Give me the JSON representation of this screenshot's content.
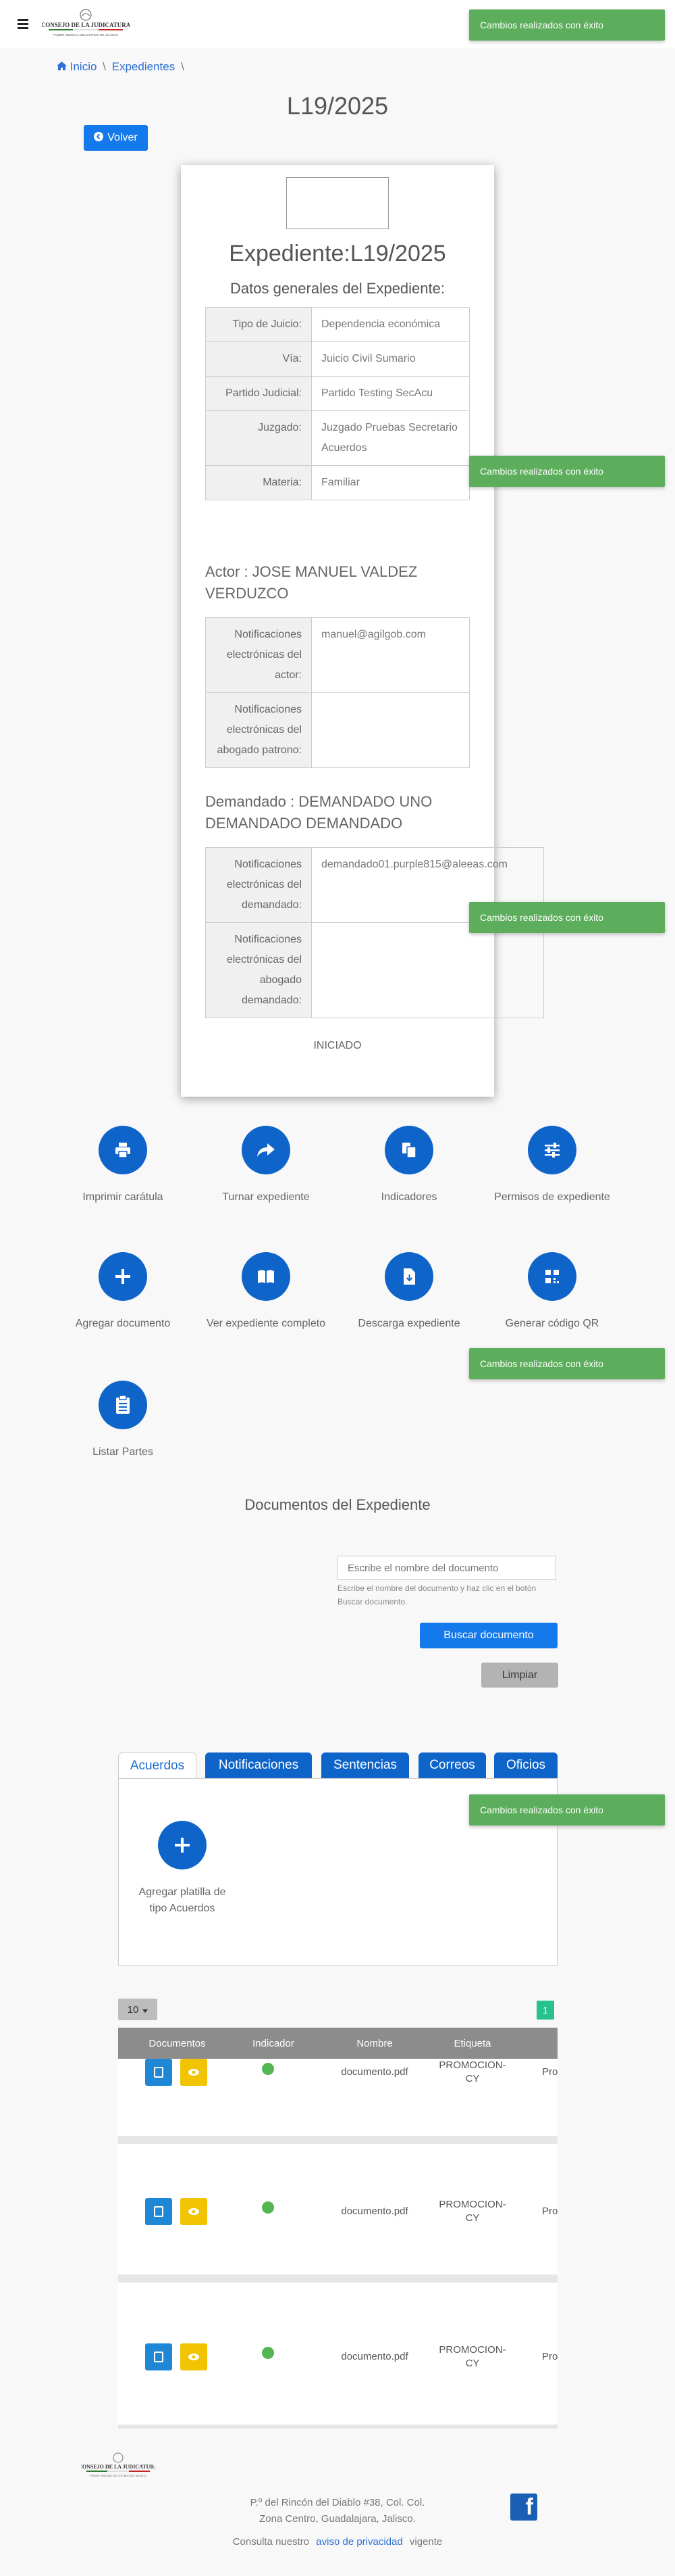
{
  "header": {
    "logo_text": "CONSEJO DE LA JUDICATURA",
    "logo_subtext": "PODER JUDICIAL DEL ESTADO DE JALISCO"
  },
  "breadcrumb": {
    "home": "Inicio",
    "expedientes": "Expedientes",
    "sep": "\\"
  },
  "page": {
    "title": "L19/2025",
    "back_label": "Volver"
  },
  "toast": {
    "message": "Cambios realizados con éxito"
  },
  "card": {
    "expediente_title": "Expediente:L19/2025",
    "datos_title": "Datos generales del Expediente:",
    "datos": [
      {
        "label": "Tipo de Juicio:",
        "value": "Dependencia económica"
      },
      {
        "label": "Vía:",
        "value": "Juicio Civil Sumario"
      },
      {
        "label": "Partido Judicial:",
        "value": "Partido Testing SecAcu"
      },
      {
        "label": "Juzgado:",
        "value": "Juzgado Pruebas Secretario Acuerdos"
      },
      {
        "label": "Materia:",
        "value": "Familiar"
      }
    ],
    "actor_heading": "Actor : JOSE MANUEL VALDEZ VERDUZCO",
    "actor_rows": [
      {
        "label": "Notificaciones electrónicas del actor:",
        "value": "manuel@agilgob.com"
      },
      {
        "label": "Notificaciones electrónicas del abogado patrono:",
        "value": ""
      }
    ],
    "demandado_heading": "Demandado : DEMANDADO UNO DEMANDADO DEMANDADO",
    "demandado_rows": [
      {
        "label": "Notificaciones electrónicas del demandado:",
        "value": "demandado01.purple815@aleeas.com"
      },
      {
        "label": "Notificaciones electrónicas del abogado demandado:",
        "value": ""
      }
    ],
    "status": "INICIADO"
  },
  "actions": [
    {
      "label": "Imprimir carátula",
      "icon": "printer-icon"
    },
    {
      "label": "Turnar expediente",
      "icon": "share-icon"
    },
    {
      "label": "Indicadores",
      "icon": "files-icon"
    },
    {
      "label": "Permisos de expediente",
      "icon": "sliders-icon"
    },
    {
      "label": "Agregar documento",
      "icon": "plus-icon"
    },
    {
      "label": "Ver expediente completo",
      "icon": "book-icon"
    },
    {
      "label": "Descarga expediente",
      "icon": "file-download-icon"
    },
    {
      "label": "Generar código QR",
      "icon": "qr-icon"
    },
    {
      "label": "Listar Partes",
      "icon": "clipboard-list-icon"
    }
  ],
  "documents": {
    "title": "Documentos del Expediente",
    "search_placeholder": "Escribe el nombre del documento",
    "search_help": "Escribe el nombre del documento y haz clic en el botón Buscar documento.",
    "search_button": "Buscar documento",
    "clear_button": "Limpiar",
    "tabs": [
      "Acuerdos",
      "Notificaciones",
      "Sentencias",
      "Correos",
      "Oficios"
    ],
    "add_template_label": "Agregar platilla de tipo Acuerdos"
  },
  "table": {
    "page_size": "10",
    "page": "1",
    "columns": [
      "Documentos",
      "Indicador",
      "Nombre",
      "Etiqueta"
    ],
    "rows": [
      {
        "nombre": "documento.pdf",
        "etiqueta": "PROMOCION-CY",
        "extra": "Pro"
      },
      {
        "nombre": "documento.pdf",
        "etiqueta": "PROMOCION-CY",
        "extra": "Pro"
      },
      {
        "nombre": "documento.pdf",
        "etiqueta": "PROMOCION-CY",
        "extra": "Pro"
      }
    ]
  },
  "footer": {
    "address_line1": "P.º del Rincón del Diablo #38, Col. Col.",
    "address_line2": "Zona Centro, Guadalajara, Jalisco.",
    "privacy_prefix": "Consulta nuestro",
    "privacy_link": "aviso de privacidad",
    "privacy_suffix": "vigente"
  }
}
